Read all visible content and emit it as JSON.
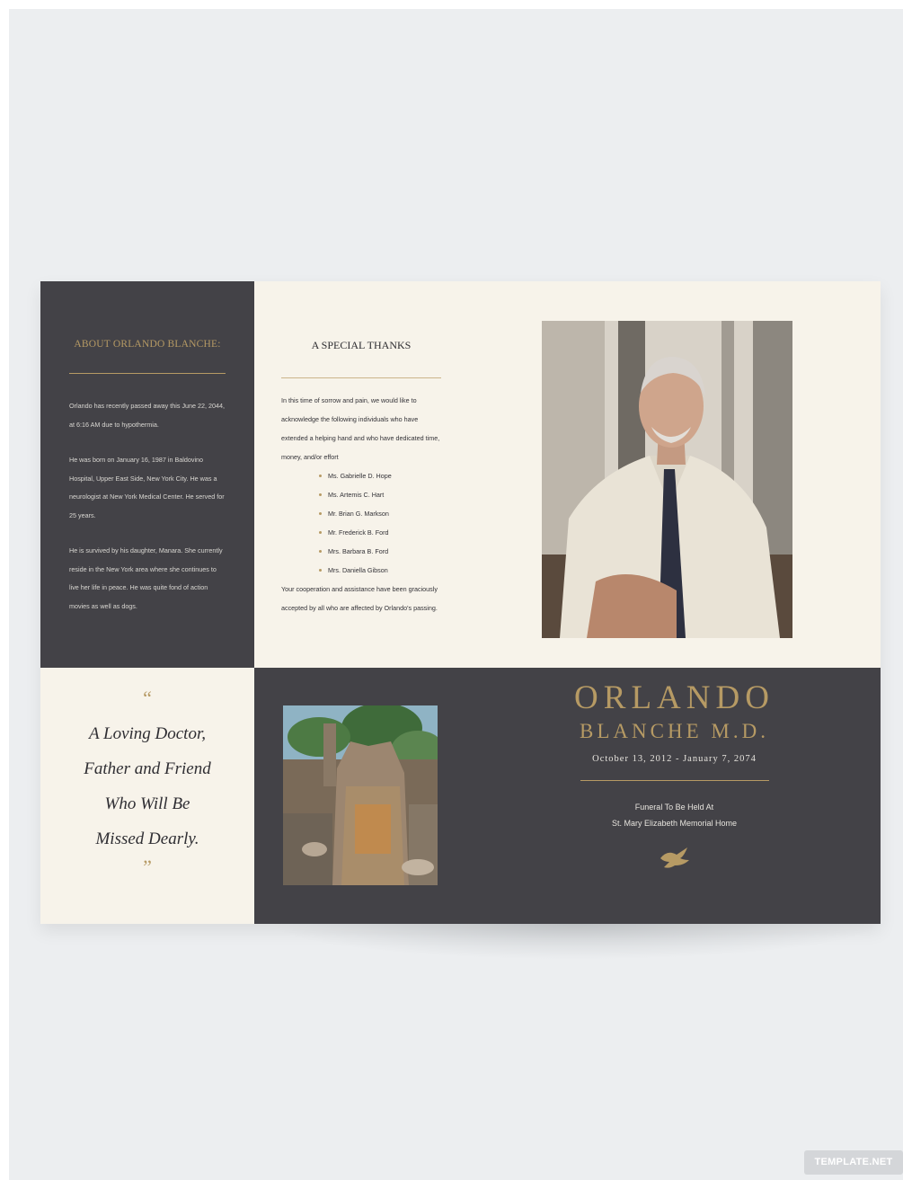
{
  "about": {
    "heading": "ABOUT ORLANDO BLANCHE:",
    "paragraphs": [
      "Orlando has recently passed away this June 22, 2044, at 6:16 AM due to hypothermia.",
      "He was born on January 16, 1987 in Baldovino Hospital, Upper East Side, New York City. He was a neurologist at New York Medical Center. He served for 25 years.",
      "He is survived by his daughter, Manara. She currently reside in the New York area where she continues to live her life in peace. He was quite fond of action movies as well as dogs."
    ]
  },
  "thanks": {
    "heading": "A SPECIAL THANKS",
    "intro": "In this time of sorrow and pain, we would like to acknowledge the following individuals who have extended a helping hand and who have dedicated time, money, and/or effort",
    "names": [
      "Ms. Gabrielle D. Hope",
      "Ms. Artemis C. Hart",
      "Mr. Brian G. Markson",
      "Mr. Frederick B. Ford",
      "Mrs. Barbara B. Ford",
      "Mrs. Daniella Gibson"
    ],
    "closing": "Your cooperation and assistance have been graciously accepted by all who are affected by Orlando's passing."
  },
  "quote": {
    "open_mark": "“",
    "lines": [
      "A Loving Doctor,",
      "Father and Friend",
      "Who Will Be",
      "Missed Dearly."
    ],
    "close_mark": "”"
  },
  "cover": {
    "first_name": "ORLANDO",
    "last_name": "BLANCHE M.D.",
    "dates": "October 13, 2012 - January 7, 2074",
    "funeral_line1": "Funeral To Be Held At",
    "funeral_line2": "St. Mary Elizabeth Memorial Home",
    "dove_icon": "dove-icon"
  },
  "watermark": {
    "text": "TEMPLATE.NET"
  },
  "colors": {
    "dark_panel": "#434247",
    "cream_panel": "#f7f3ea",
    "gold_accent": "#b69a64",
    "page_background": "#eceef0"
  }
}
